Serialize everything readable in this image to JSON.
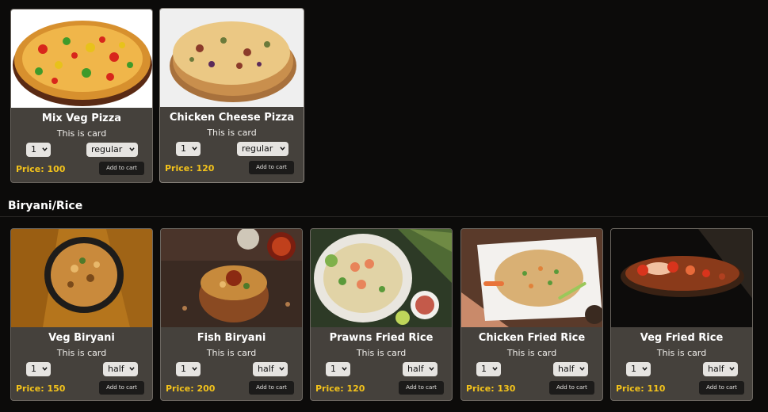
{
  "top_items": [
    {
      "title": "Mix Veg Pizza",
      "desc": "This is card",
      "qty": "1",
      "size": "regular",
      "price": "Price: 100",
      "cart": "Add to cart"
    },
    {
      "title": "Chicken Cheese Pizza",
      "desc": "This is card",
      "qty": "1",
      "size": "regular",
      "price": "Price: 120",
      "cart": "Add to cart"
    }
  ],
  "section": {
    "title": "Biryani/Rice"
  },
  "rice_items": [
    {
      "title": "Veg Biryani",
      "desc": "This is card",
      "qty": "1",
      "size": "half",
      "price": "Price: 150",
      "cart": "Add to cart"
    },
    {
      "title": "Fish Biryani",
      "desc": "This is card",
      "qty": "1",
      "size": "half",
      "price": "Price: 200",
      "cart": "Add to cart"
    },
    {
      "title": "Prawns Fried Rice",
      "desc": "This is card",
      "qty": "1",
      "size": "half",
      "price": "Price: 120",
      "cart": "Add to cart"
    },
    {
      "title": "Chicken Fried Rice",
      "desc": "This is card",
      "qty": "1",
      "size": "half",
      "price": "Price: 130",
      "cart": "Add to cart"
    },
    {
      "title": "Veg Fried Rice",
      "desc": "This is card",
      "qty": "1",
      "size": "half",
      "price": "Price: 110",
      "cart": "Add to cart"
    }
  ],
  "colors": {
    "page_bg": "#0c0b0a",
    "card_bg": "#45413c",
    "price": "#f2c21b",
    "button_bg": "#1c1b1a"
  },
  "icons": {
    "select_chevron": "chevron-down-icon"
  }
}
